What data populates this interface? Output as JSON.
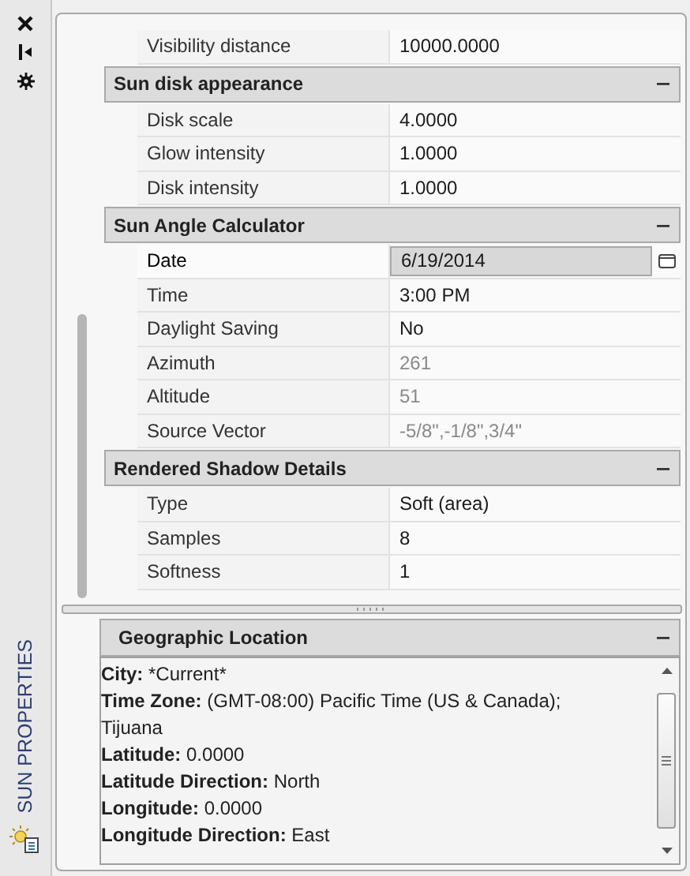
{
  "palette": {
    "title": "SUN PROPERTIES"
  },
  "top_rows": [
    {
      "label": "Visibility distance",
      "value": "10000.0000",
      "disabled": false,
      "selected": false
    }
  ],
  "sections": [
    {
      "title": "Sun disk appearance",
      "expanded": true,
      "rows": [
        {
          "label": "Disk scale",
          "value": "4.0000",
          "disabled": false,
          "selected": false
        },
        {
          "label": "Glow intensity",
          "value": "1.0000",
          "disabled": false,
          "selected": false
        },
        {
          "label": "Disk intensity",
          "value": "1.0000",
          "disabled": false,
          "selected": false
        }
      ]
    },
    {
      "title": "Sun Angle Calculator",
      "expanded": true,
      "rows": [
        {
          "label": "Date",
          "value": "6/19/2014",
          "disabled": false,
          "selected": true
        },
        {
          "label": "Time",
          "value": "3:00 PM",
          "disabled": false,
          "selected": false
        },
        {
          "label": "Daylight Saving",
          "value": "No",
          "disabled": false,
          "selected": false
        },
        {
          "label": "Azimuth",
          "value": "261",
          "disabled": true,
          "selected": false
        },
        {
          "label": "Altitude",
          "value": "51",
          "disabled": true,
          "selected": false
        },
        {
          "label": "Source Vector",
          "value": "-5/8\",-1/8\",3/4\"",
          "disabled": true,
          "selected": false
        }
      ]
    },
    {
      "title": "Rendered Shadow Details",
      "expanded": true,
      "rows": [
        {
          "label": "Type",
          "value": "Soft (area)",
          "disabled": false,
          "selected": false
        },
        {
          "label": "Samples",
          "value": "8",
          "disabled": false,
          "selected": false
        },
        {
          "label": "Softness",
          "value": "1",
          "disabled": false,
          "selected": false
        }
      ]
    }
  ],
  "geographic_location": {
    "title": "Geographic Location",
    "expanded": true,
    "lines": [
      {
        "label": "City:",
        "value": "*Current*"
      },
      {
        "label": "Time Zone:",
        "value": "(GMT-08:00) Pacific Time (US & Canada); Tijuana"
      },
      {
        "label": "Latitude:",
        "value": "0.0000"
      },
      {
        "label": "Latitude Direction:",
        "value": "North"
      },
      {
        "label": "Longitude:",
        "value": "0.0000"
      },
      {
        "label": "Longitude Direction:",
        "value": "East"
      }
    ]
  }
}
